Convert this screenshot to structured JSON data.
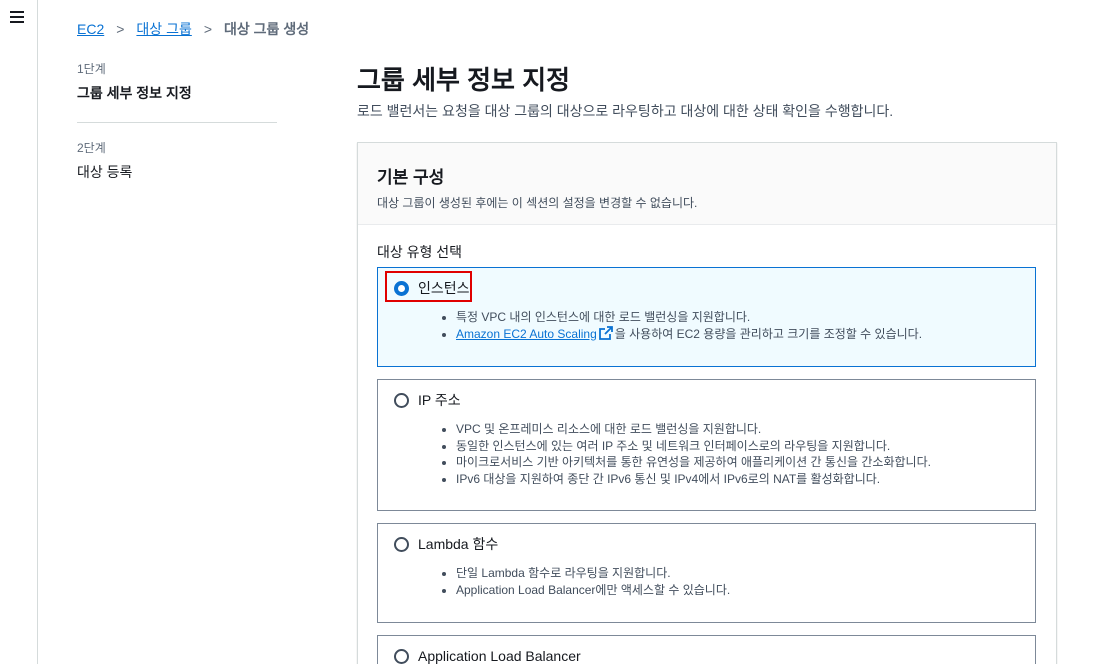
{
  "breadcrumb": {
    "items": [
      "EC2",
      "대상 그룹"
    ],
    "current": "대상 그룹 생성",
    "separator": ">"
  },
  "steps": [
    {
      "num": "1단계",
      "title": "그룹 세부 정보 지정"
    },
    {
      "num": "2단계",
      "title": "대상 등록"
    }
  ],
  "page": {
    "title": "그룹 세부 정보 지정",
    "description": "로드 밸런서는 요청을 대상 그룹의 대상으로 라우팅하고 대상에 대한 상태 확인을 수행합니다."
  },
  "panel": {
    "title": "기본 구성",
    "description": "대상 그룹이 생성된 후에는 이 섹션의 설정을 변경할 수 없습니다.",
    "field_label": "대상 유형 선택"
  },
  "options": {
    "instance": {
      "label": "인스턴스",
      "selected": true,
      "bullet1": "특정 VPC 내의 인스턴스에 대한 로드 밸런싱을 지원합니다.",
      "bullet2_link": "Amazon EC2 Auto Scaling",
      "bullet2_rest": "을 사용하여 EC2 용량을 관리하고 크기를 조정할 수 있습니다."
    },
    "ip": {
      "label": "IP 주소",
      "bullets": [
        "VPC 및 온프레미스 리소스에 대한 로드 밸런싱을 지원합니다.",
        "동일한 인스턴스에 있는 여러 IP 주소 및 네트워크 인터페이스로의 라우팅을 지원합니다.",
        "마이크로서비스 기반 아키텍처를 통한 유연성을 제공하여 애플리케이션 간 통신을 간소화합니다.",
        "IPv6 대상을 지원하여 종단 간 IPv6 통신 및 IPv4에서 IPv6로의 NAT를 활성화합니다."
      ]
    },
    "lambda": {
      "label": "Lambda 함수",
      "bullets": [
        "단일 Lambda 함수로 라우팅을 지원합니다.",
        "Application Load Balancer에만 액세스할 수 있습니다."
      ]
    },
    "alb": {
      "label": "Application Load Balancer"
    }
  },
  "colors": {
    "link": "#0972d3",
    "selected_bg": "#f0fbff",
    "highlight": "#e00000"
  }
}
